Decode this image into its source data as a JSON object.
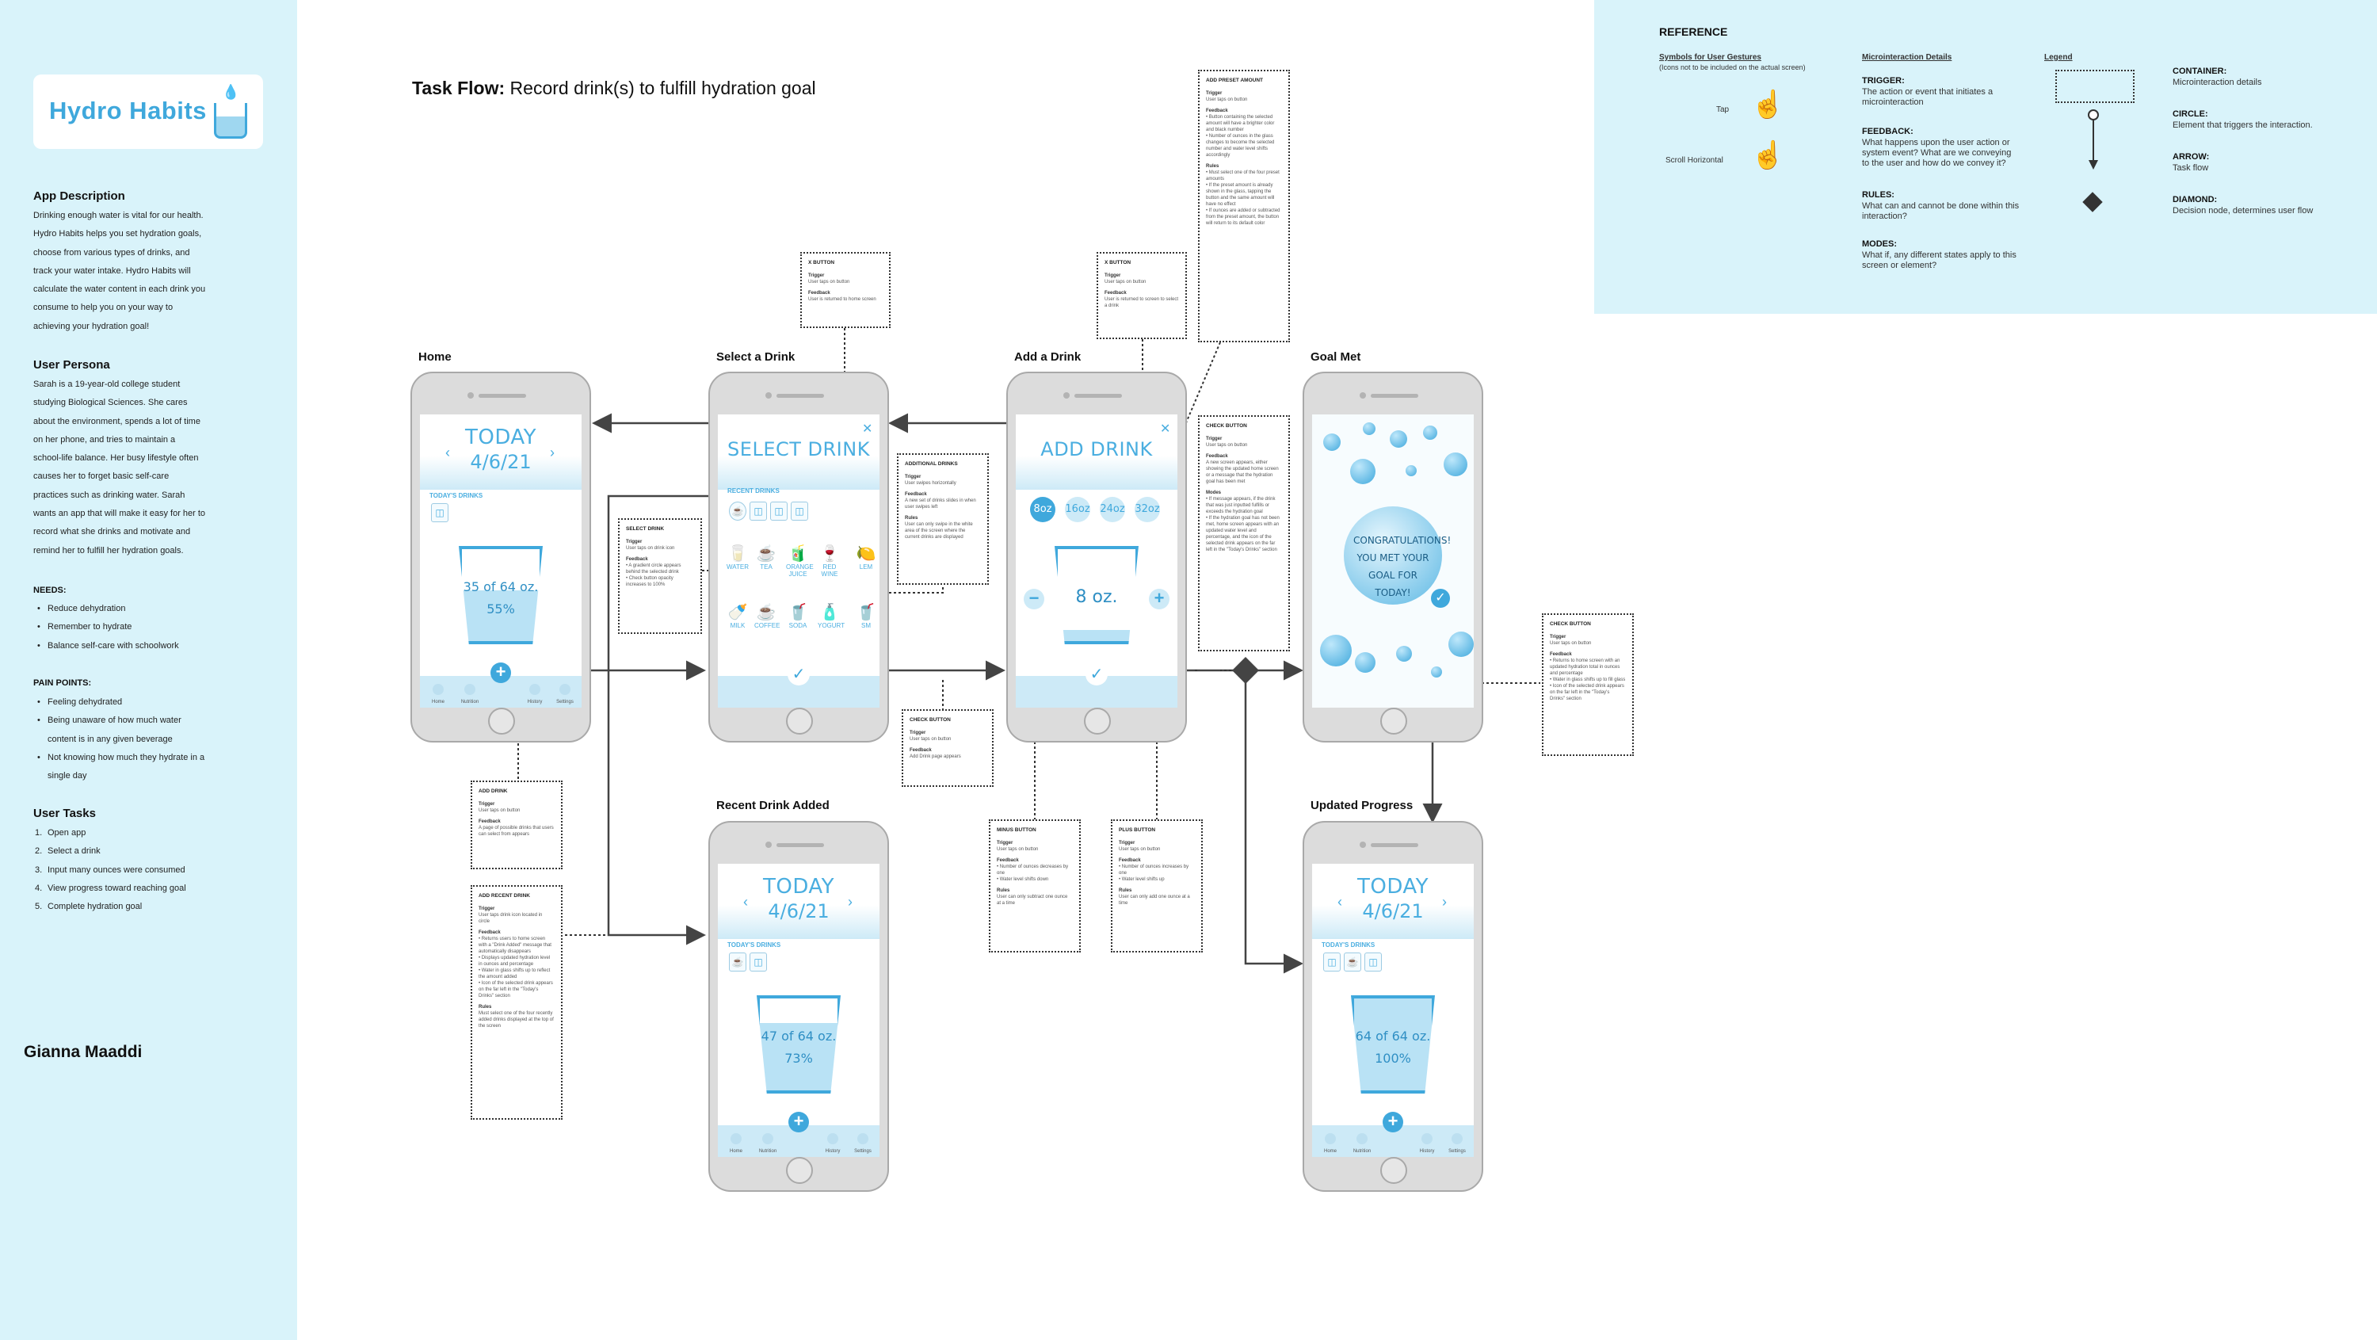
{
  "app": {
    "name": "Hydro Habits"
  },
  "sidebar": {
    "description_heading": "App Description",
    "description": [
      "Drinking enough water is vital for our health.",
      "Hydro Habits helps you set hydration goals,",
      "choose from various types of drinks, and",
      "track your water intake. Hydro Habits will",
      "calculate the water content in each drink you",
      "consume to help you on your way to",
      "achieving your hydration goal!"
    ],
    "persona_heading": "User Persona",
    "persona": [
      "Sarah is a 19-year-old college student",
      "studying Biological Sciences. She cares",
      "about the environment, spends a lot of time",
      "on her phone, and tries to maintain a",
      "school-life balance. Her busy lifestyle often",
      "causes her to forget basic self-care",
      "practices such as drinking water. Sarah",
      "wants an app that will make it easy for her to",
      "record what she drinks and motivate and",
      "remind her to fulfill her hydration goals."
    ],
    "needs_heading": "NEEDS:",
    "needs": [
      "Reduce dehydration",
      "Remember to hydrate",
      "Balance self-care with schoolwork"
    ],
    "pain_heading": "PAIN POINTS:",
    "pain_points": [
      "Feeling dehydrated",
      "Being unaware of how much water",
      "content is in any given beverage",
      "Not knowing how much they hydrate in a",
      "single day"
    ],
    "tasks_heading": "User Tasks",
    "tasks": [
      "Open app",
      "Select a drink",
      "Input many ounces were consumed",
      "View progress toward reaching goal",
      "Complete hydration goal"
    ],
    "author": "Gianna Maaddi"
  },
  "task_flow": {
    "label": "Task Flow:",
    "title": "Record drink(s) to fulfill hydration goal"
  },
  "reference": {
    "heading": "REFERENCE",
    "symbols_heading": "Symbols for User Gestures",
    "symbols_note": "(Icons not to be included on the actual screen)",
    "tap": "Tap",
    "scroll": "Scroll Horizontal",
    "micro_heading": "Microinteraction Details",
    "trigger_h": "TRIGGER:",
    "trigger": "The action or event that initiates a microinteraction",
    "feedback_h": "FEEDBACK:",
    "feedback": "What happens upon the user action or system event? What are we conveying to the user and how do we convey it?",
    "rules_h": "RULES:",
    "rules": "What can and cannot be done within this interaction?",
    "modes_h": "MODES:",
    "modes": "What if, any different states apply to this screen or element?",
    "legend_heading": "Legend",
    "container_h": "CONTAINER:",
    "container": "Microinteraction details",
    "circle_h": "CIRCLE:",
    "circle": "Element that triggers the interaction.",
    "arrow_h": "ARROW:",
    "arrow": "Task flow",
    "diamond_h": "DIAMOND:",
    "diamond": "Decision node, determines user flow"
  },
  "screens": {
    "home": {
      "label": "Home",
      "title": "TODAY",
      "date": "4/6/21",
      "section": "TODAY'S DRINKS",
      "amount": "35 of 64 oz.",
      "percent": "55%",
      "fill": 0.55
    },
    "select": {
      "label": "Select a Drink",
      "title": "SELECT DRINK",
      "section": "RECENT DRINKS",
      "drinks_row1": [
        "WATER",
        "TEA",
        "ORANGE JUICE",
        "RED WINE",
        "LEM"
      ],
      "drinks_row2": [
        "MILK",
        "COFFEE",
        "SODA",
        "YOGURT",
        "SM"
      ]
    },
    "add": {
      "label": "Add a Drink",
      "title": "ADD DRINK",
      "presets": [
        "8oz",
        "16oz",
        "24oz",
        "32oz"
      ],
      "amount": "8 oz."
    },
    "goal": {
      "label": "Goal Met",
      "message": "CONGRATULATIONS! YOU MET YOUR GOAL FOR TODAY!"
    },
    "recent": {
      "label": "Recent Drink Added",
      "title": "TODAY",
      "date": "4/6/21",
      "section": "TODAY'S DRINKS",
      "amount": "47 of 64 oz.",
      "percent": "73%",
      "fill": 0.73
    },
    "updated": {
      "label": "Updated Progress",
      "title": "TODAY",
      "date": "4/6/21",
      "section": "TODAY'S DRINKS",
      "amount": "64 of 64 oz.",
      "percent": "100%",
      "fill": 1.0
    },
    "nav": [
      "Home",
      "Nutrition",
      "",
      "History",
      "Settings"
    ]
  },
  "notes": {
    "x_button_1": {
      "title": "X BUTTON",
      "trigger": "User taps on button",
      "feedback": "User is returned to home screen"
    },
    "x_button_2": {
      "title": "X BUTTON",
      "trigger": "User taps on button",
      "feedback": "User is returned to screen to select a drink"
    },
    "add_preset": {
      "title": "ADD PRESET AMOUNT",
      "trigger": "User taps on button",
      "feedback": [
        "Button containing the selected amount will have a brighter color and black number",
        "Number of ounces in the glass changes to become the selected number and water level shifts accordingly"
      ],
      "rules": [
        "Must select one of the four preset amounts",
        "If the preset amount is already shown in the glass, tapping the button and the same amount will have no effect",
        "If ounces are added or subtracted from the preset amount, the button will return to its default color"
      ]
    },
    "select_drink": {
      "title": "SELECT DRINK",
      "trigger": "User taps on drink icon",
      "feedback": [
        "A gradient circle appears behind the selected drink",
        "Check button opacity increases to 100%"
      ]
    },
    "additional_drinks": {
      "title": "ADDITIONAL DRINKS",
      "trigger": "User swipes horizontally",
      "feedback": "A new set of drinks slides in when user swipes left",
      "rules": "User can only swipe in the white area of the screen where the current drinks are displayed"
    },
    "check_button_1": {
      "title": "CHECK BUTTON",
      "trigger": "User taps on button",
      "feedback": "Add Drink page appears"
    },
    "check_button_2": {
      "title": "CHECK BUTTON",
      "trigger": "User taps on button",
      "feedback": "A new screen appears, either showing the updated home screen or a message that the hydration goal has been met",
      "modes": [
        "If message appears, if the drink that was just inputted fulfills or exceeds the hydration goal",
        "If the hydration goal has not been met, home screen appears with an updated water level and percentage, and the icon of the selected drink appears on the far left in the \"Today's Drinks\" section"
      ]
    },
    "check_button_3": {
      "title": "CHECK BUTTON",
      "trigger": "User taps on button",
      "feedback": [
        "Returns to home screen with an updated hydration total in ounces and percentage",
        "Water in glass shifts up to fill glass",
        "Icon of the selected drink appears on the far left in the \"Today's Drinks\" section"
      ]
    },
    "add_drink": {
      "title": "ADD DRINK",
      "trigger": "User taps on button",
      "feedback": "A page of possible drinks that users can select from appears"
    },
    "add_recent": {
      "title": "ADD RECENT DRINK",
      "trigger": "User taps drink icon located in circle",
      "feedback": [
        "Returns users to home screen with a \"Drink Added\" message that automatically disappears",
        "Displays updated hydration level in ounces and percentage",
        "Water in glass shifts up to reflect the amount added",
        "Icon of the selected drink appears on the far left in the \"Today's Drinks\" section"
      ],
      "rules": "Must select one of the four recently added drinks displayed at the top of the screen"
    },
    "minus_button": {
      "title": "MINUS BUTTON",
      "trigger": "User taps on button",
      "feedback": [
        "Number of ounces decreases by one",
        "Water level shifts down"
      ],
      "rules": "User can only subtract one ounce at a time"
    },
    "plus_button": {
      "title": "PLUS BUTTON",
      "trigger": "User taps on button",
      "feedback": [
        "Number of ounces increases by one",
        "Water level shifts up"
      ],
      "rules": "User can only add one ounce at a time"
    }
  }
}
